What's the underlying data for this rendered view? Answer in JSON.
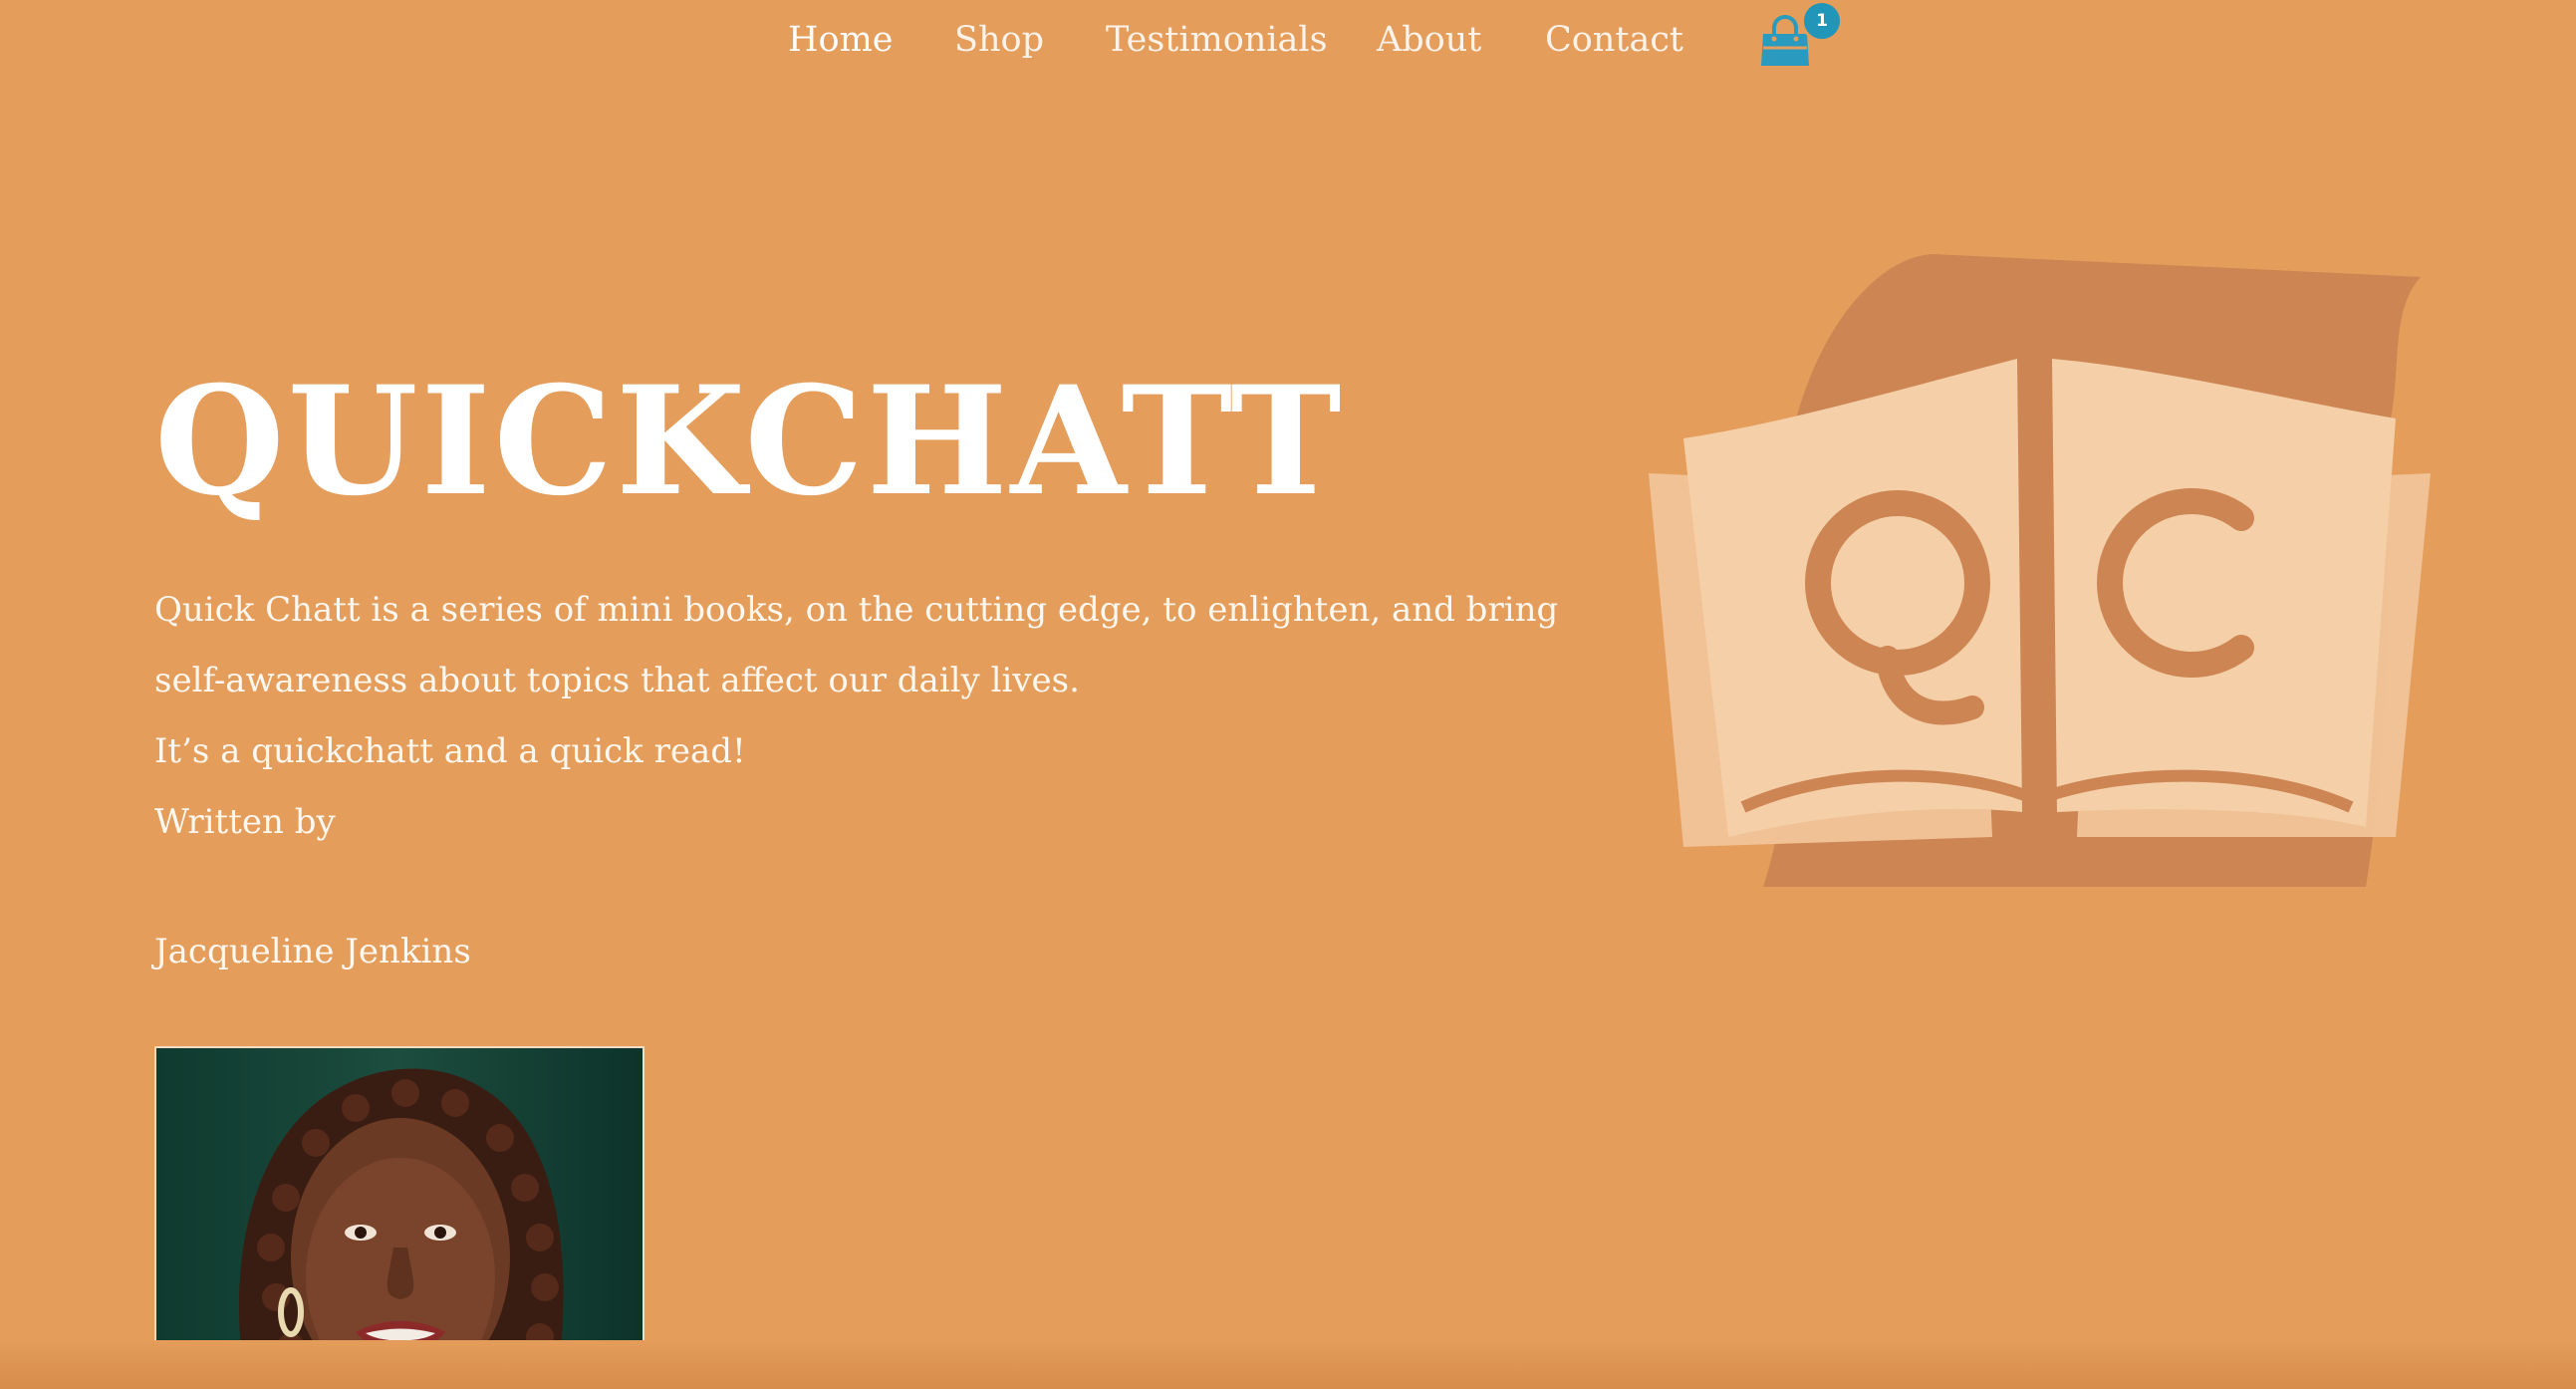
{
  "nav": {
    "items": [
      {
        "label": "Home"
      },
      {
        "label": "Shop"
      },
      {
        "label": "Testimonials"
      },
      {
        "label": "About"
      },
      {
        "label": "Contact"
      }
    ],
    "cart_count": "1",
    "cart_icon": "shopping-bag-icon",
    "cart_color": "#2a9bbf"
  },
  "hero": {
    "title": "QUICKCHATT",
    "line1": "Quick Chatt is a series of mini books, on the cutting edge, to enlighten, and bring",
    "line2": "self-awareness about topics that affect our daily lives.",
    "line3": "It’s a quickchatt and a quick read!",
    "line4": "Written by",
    "author": "Jacqueline Jenkins"
  },
  "colors": {
    "background": "#e49d5a",
    "logo_light": "#f5cfa7",
    "logo_dark": "#cc8553",
    "accent": "#2196b8"
  }
}
